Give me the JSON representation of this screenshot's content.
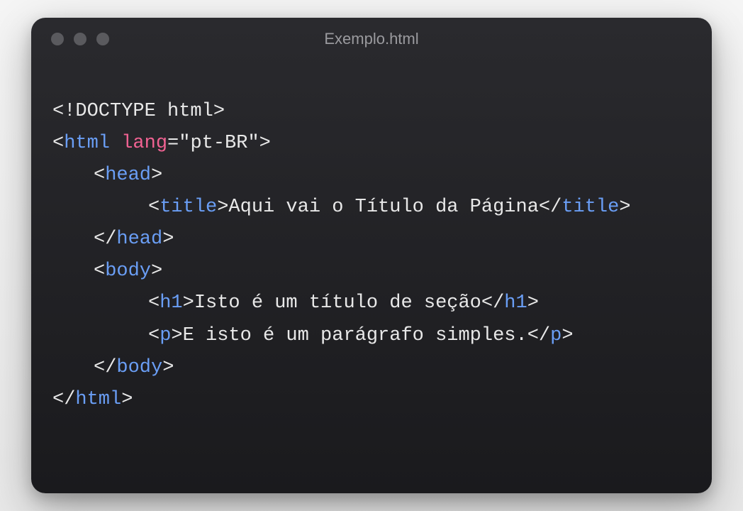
{
  "window": {
    "title": "Exemplo.html"
  },
  "code": {
    "line1": {
      "doctype": "<!DOCTYPE html>"
    },
    "line2": {
      "open": "<",
      "tag": "html",
      "space": " ",
      "attr": "lang",
      "eq": "=",
      "quote1": "\"",
      "value": "pt-BR",
      "quote2": "\"",
      "close": ">"
    },
    "line3": {
      "open": "<",
      "tag": "head",
      "close": ">"
    },
    "line4": {
      "open": "<",
      "tag": "title",
      "close": ">",
      "text": "Aqui vai o Título da Página",
      "open2": "</",
      "tag2": "title",
      "close2": ">"
    },
    "line5": {
      "open": "</",
      "tag": "head",
      "close": ">"
    },
    "line6": {
      "open": "<",
      "tag": "body",
      "close": ">"
    },
    "line7": {
      "open": "<",
      "tag": "h1",
      "close": ">",
      "text": "Isto é um título de seção",
      "open2": "</",
      "tag2": "h1",
      "close2": ">"
    },
    "line8": {
      "open": "<",
      "tag": "p",
      "close": ">",
      "text": "E isto é um parágrafo simples.",
      "open2": "</",
      "tag2": "p",
      "close2": ">"
    },
    "line9": {
      "open": "</",
      "tag": "body",
      "close": ">"
    },
    "line10": {
      "open": "</",
      "tag": "html",
      "close": ">"
    }
  }
}
